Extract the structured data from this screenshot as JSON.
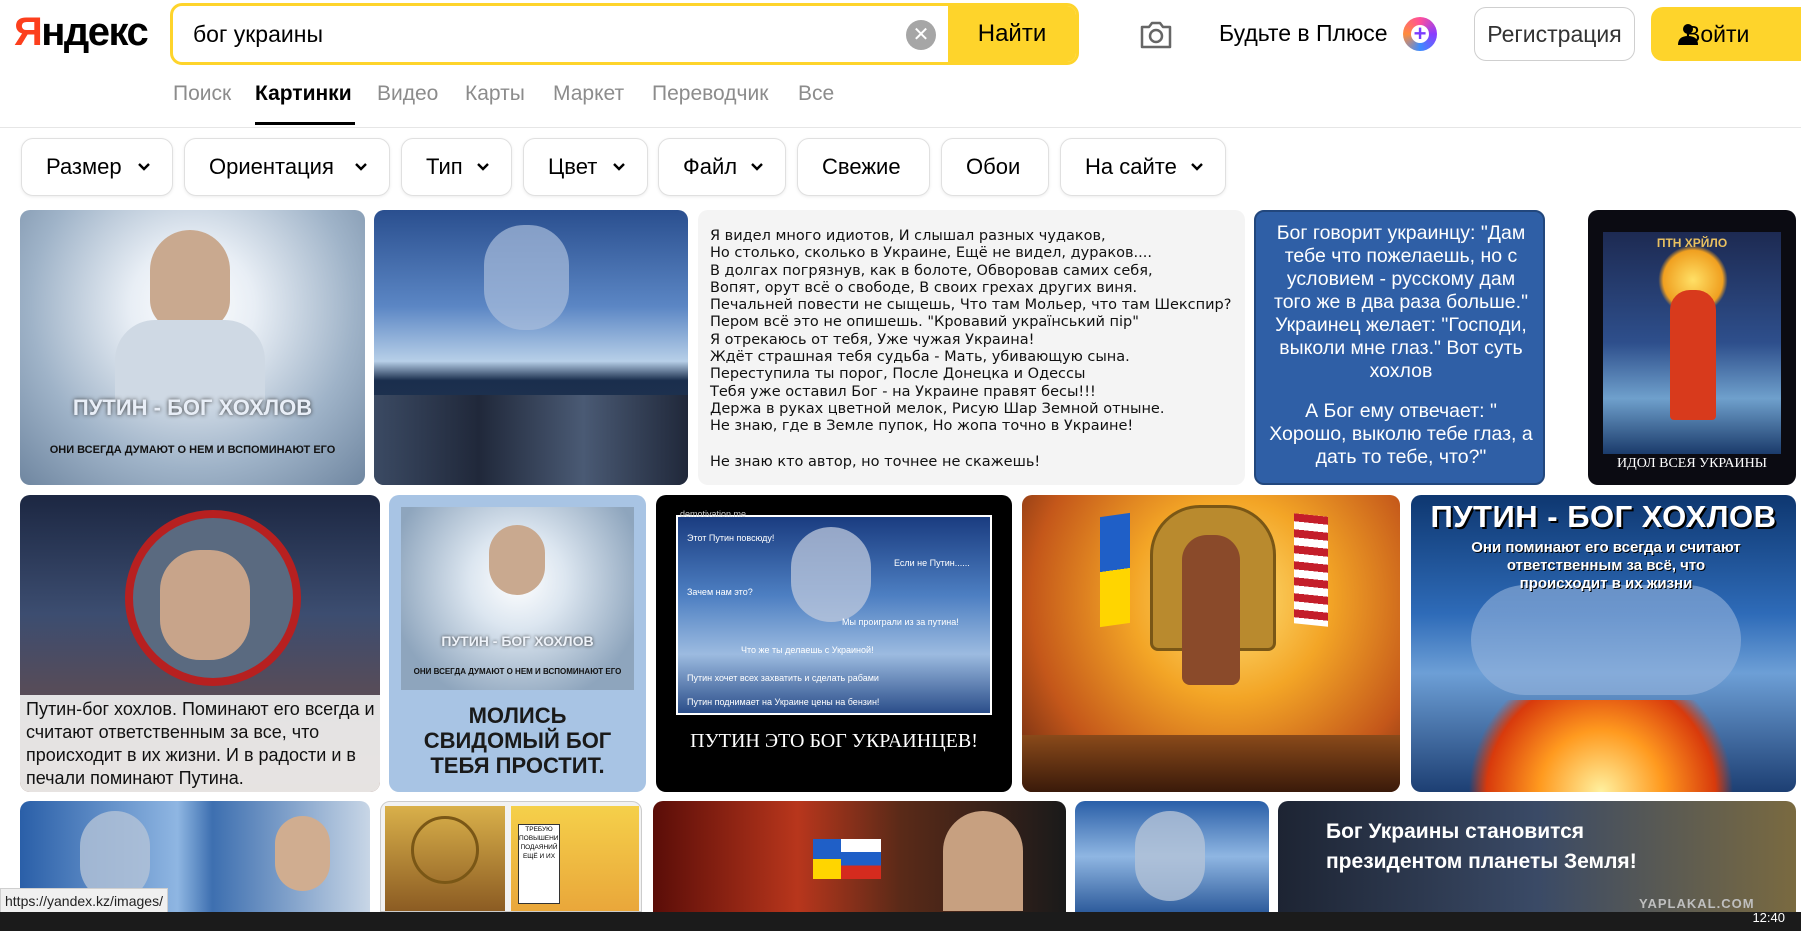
{
  "header": {
    "logo": "Яндекс",
    "logo_first": "Я",
    "logo_rest": "ндекс",
    "search_value": "бог украины",
    "clear_glyph": "✕",
    "search_button": "Найти",
    "plus_label": "Будьте в Плюсе",
    "plus_glyph": "+",
    "register_button": "Регистрация",
    "login_button": "Войти"
  },
  "tabs": [
    {
      "label": "Поиск",
      "active": false
    },
    {
      "label": "Картинки",
      "active": true
    },
    {
      "label": "Видео",
      "active": false
    },
    {
      "label": "Карты",
      "active": false
    },
    {
      "label": "Маркет",
      "active": false
    },
    {
      "label": "Переводчик",
      "active": false
    },
    {
      "label": "Все",
      "active": false
    }
  ],
  "filters": [
    {
      "label": "Размер",
      "dropdown": true
    },
    {
      "label": "Ориентация",
      "dropdown": true
    },
    {
      "label": "Тип",
      "dropdown": true
    },
    {
      "label": "Цвет",
      "dropdown": true
    },
    {
      "label": "Файл",
      "dropdown": true
    },
    {
      "label": "Свежие",
      "dropdown": false
    },
    {
      "label": "Обои",
      "dropdown": false
    },
    {
      "label": "На сайте",
      "dropdown": true
    }
  ],
  "results": {
    "r1c1_title": "ПУТИН - БОГ ХОХЛОВ",
    "r1c1_sub": "ОНИ ВСЕГДА ДУМАЮТ О НЕМ И ВСПОМИНАЮТ ЕГО",
    "r1c3_poem": [
      "Я видел много идиотов, И слышал разных чудаков,",
      "Но столько, сколько в Украине, Ещё не видел, дураков....",
      "В долгах погрязнув, как в болоте, Обворовав самих себя,",
      "Вопят, орут всё о свободе, В своих грехах других виня.",
      "Печальней повести не сыщешь, Что там Мольер, что там Шекспир?",
      "Пером всё это не опишешь. \"Кровавий український пір\"",
      "Я отрекаюсь от тебя, Уже чужая Украина!",
      "Ждёт страшная тебя судьба - Мать, убивающую сына.",
      "Переступила ты порог, После Донецка и Одессы",
      "Тебя уже оставил Бог - на Украине правят бесы!!!",
      "Держа в руках цветной мелок, Рисую Шар Земной отныне.",
      "Не знаю, где в Земле пупок, Но жопа точно в Украине!"
    ],
    "r1c3_footer": "Не знаю кто автор, но точнее не скажешь!",
    "r1c4_text": "Бог говорит украинцу: \"Дам тебе что пожелаешь, но с условием - русскому дам того же в два раза больше.\" Украинец желает: \"Господи, выколи мне глаз.\" Вот суть хохлов",
    "r1c4_text2": "А Бог ему отвечает: \" Хорошо, выколю тебе глаз, а дать то тебе, что?\"",
    "r1c5_top": "ПТН ХРЙЛО",
    "r1c5_caption": "ИДОЛ ВСЕЯ УКРАИНЫ",
    "r2c1_caption": "Путин-бог хохлов. Поминают его всегда и считают ответственным за все, что происходит в их жизни. И в радости и в печали поминают Путина.",
    "r2c2_title": "ПУТИН - БОГ ХОХЛОВ",
    "r2c2_sub": "ОНИ ВСЕГДА ДУМАЮТ О НЕМ И ВСПОМИНАЮТ ЕГО",
    "r2c2_caption": "МОЛИСЬ СВИДОМЫЙ БОГ ТЕБЯ ПРОСТИТ.",
    "r2c3_site": "demotivation.me",
    "r2c3_lines": [
      "Этот Путин повсюду!",
      "Если не Путин......",
      "Зачем нам это?",
      "Мы проиграли из за путина!",
      "Что же ты делаешь с Украиной!",
      "Путин хочет всех захватить и сделать рабами",
      "Путин поднимает на Украине цены на бензин!"
    ],
    "r2c3_caption": "ПУТИН ЭТО БОГ УКРАИНЦЕВ!",
    "r2c5_title": "ПУТИН - БОГ ХОХЛОВ",
    "r2c5_sub": "Они поминают его всегда и считают ответственным за всё, что происходит в их жизни",
    "r3c2_sign": "ТРЕБУЮ ПОВЫШЕНИЕ ПОДАЯНИЙ ЕЩЁ И ИХ",
    "r3c5_caption": "Бог Украины становится президентом планеты Земля!"
  },
  "status_url": "https://yandex.kz/images/",
  "watermark": "YAPLAKAL.COM",
  "clock": "12:40",
  "colors": {
    "accent": "#fed42b",
    "logo_red": "#fc3f1d"
  }
}
